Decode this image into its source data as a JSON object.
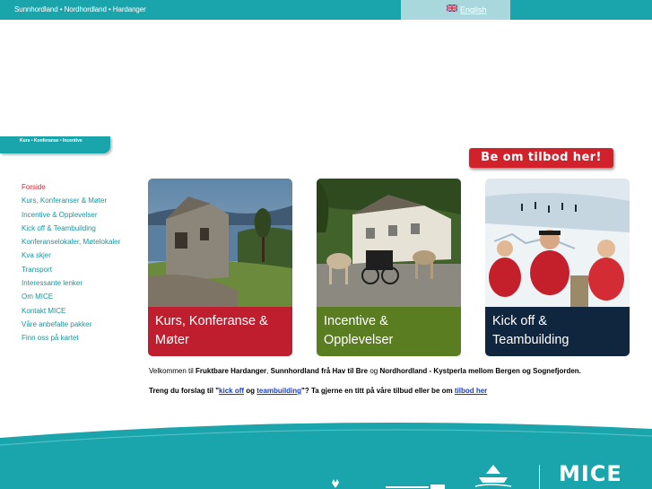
{
  "topbar": {
    "regions": "Sunnhordland • Nordhordland • Hardanger",
    "language_link": "English",
    "flag_icon": "uk-flag-icon"
  },
  "tab": {
    "text": "Kurs • Konferanse • Incentive"
  },
  "offer_button": {
    "label": "Be om tilbod her!"
  },
  "nav": {
    "items": [
      "Forside",
      "Kurs, Konferanser & Møter",
      "Incentive & Opplevelser",
      "Kick off & Teambuilding",
      "Konferanselokaler, Møtelokaler",
      "Kva skjer",
      "Transport",
      "Interessante lenker",
      "Om MICE",
      "Kontakt MICE",
      "Våre anbefalte pakker",
      "Finn oss på kartet"
    ]
  },
  "cards": [
    {
      "line1": "Kurs, Konferanse &",
      "line2": "Møter"
    },
    {
      "line1": "Incentive &",
      "line2": "Opplevelser"
    },
    {
      "line1": "Kick off &",
      "line2": "Teambuilding"
    }
  ],
  "intro": {
    "prefix": "Velkommen til ",
    "b1": "Fruktbare Hardanger",
    "s1": ", ",
    "b2": "Sunnhordland frå Hav til Bre",
    "s2": " og ",
    "b3": "Nordhordland - Kystperla mellom Bergen og Sognefjorden."
  },
  "intro2": {
    "p1": "Treng du forslag til \"",
    "link1": "kick off",
    "p2": " og ",
    "link2": "teambuilding",
    "p3": "\"? Ta gjerne en titt på våre tilbud eller be om ",
    "link3": "tilbod her"
  },
  "footer": {
    "logo": "MICE"
  },
  "colors": {
    "teal": "#1aa5ad",
    "red": "#be1e2d",
    "green": "#5a7d22",
    "navy": "#10263f",
    "offer_red": "#d1222c"
  }
}
